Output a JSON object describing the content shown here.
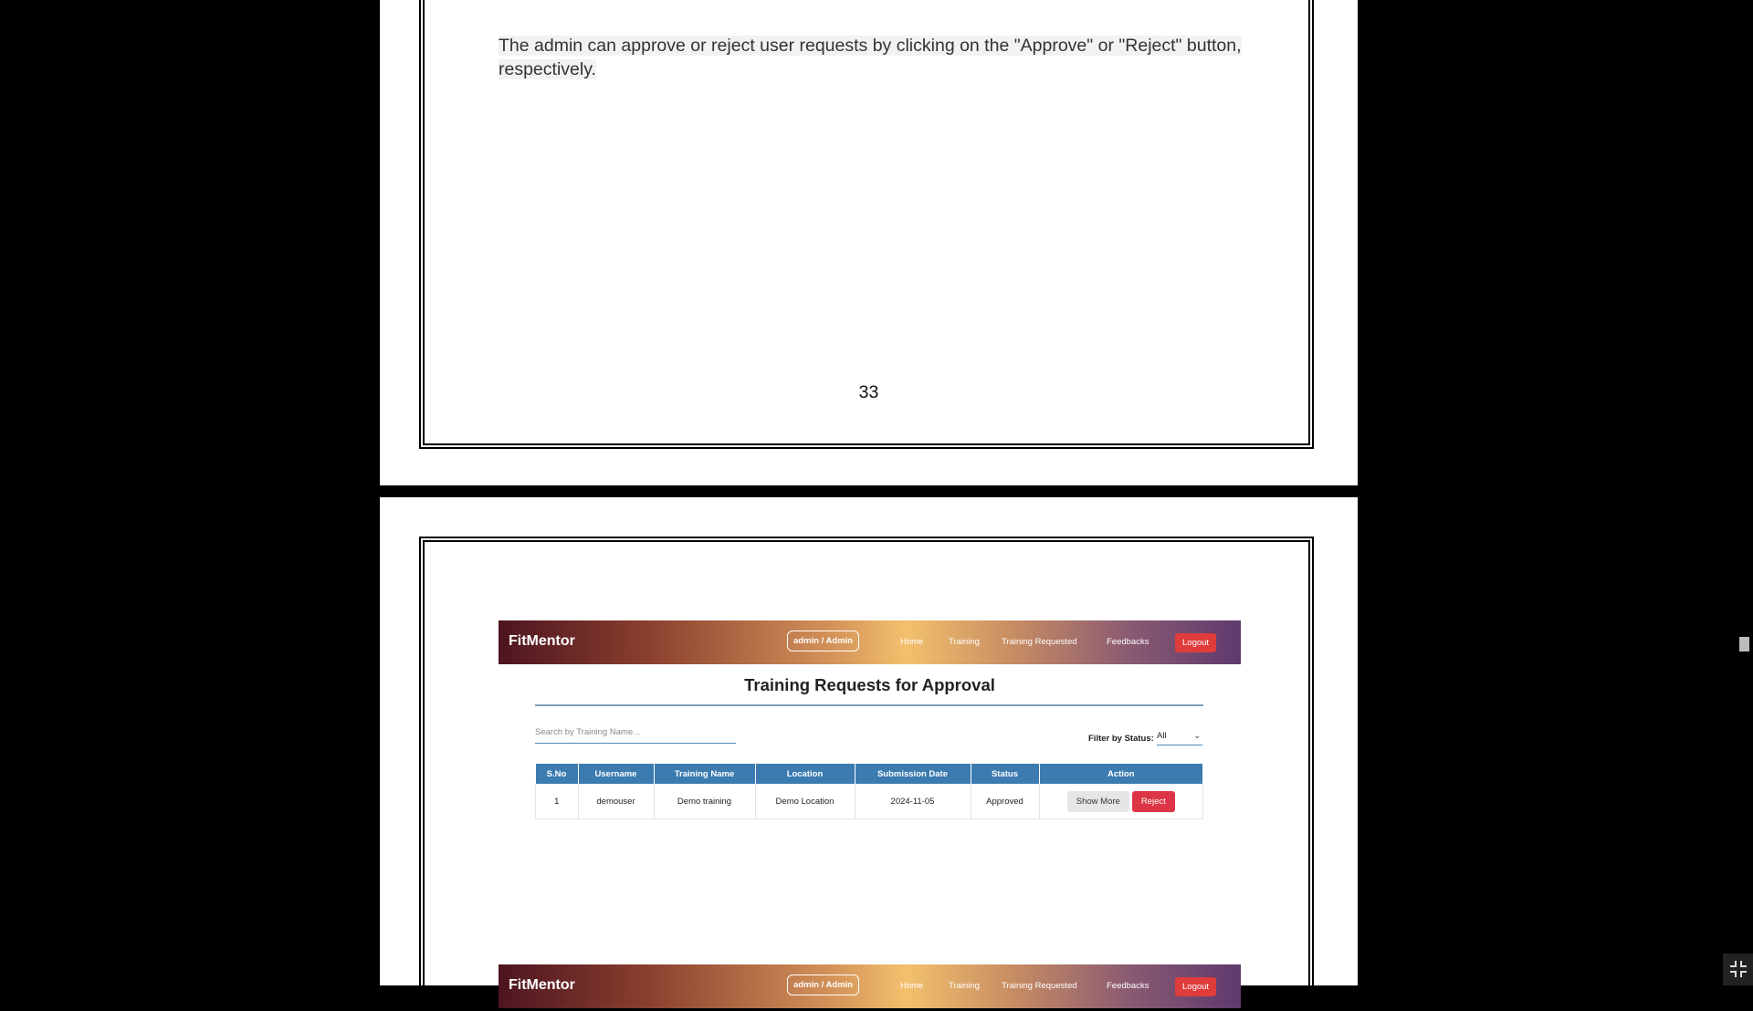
{
  "page1": {
    "paragraph": "The admin can approve or reject user requests by clicking on the \"Approve\" or \"Reject\" button, respectively.",
    "page_number": "33"
  },
  "page2": {
    "screenshot": {
      "brand": "FitMentor",
      "role_badge": "admin / Admin",
      "nav": [
        "Home",
        "Training",
        "Training Requested",
        "Feedbacks"
      ],
      "logout": "Logout",
      "title": "Training Requests for Approval",
      "search_placeholder": "Search by Training Name...",
      "filter_label": "Filter by Status:",
      "filter_value": "All",
      "columns": [
        "S.No",
        "Username",
        "Training Name",
        "Location",
        "Submission Date",
        "Status",
        "Action"
      ],
      "rows": [
        {
          "sno": "1",
          "username": "demouser",
          "training": "Demo training",
          "location": "Demo Location",
          "date": "2024-11-05",
          "status": "Approved",
          "show_more": "Show More",
          "reject": "Reject"
        }
      ]
    },
    "screenshot2": {
      "brand": "FitMentor",
      "role_badge": "admin / Admin",
      "nav": [
        "Home",
        "Training",
        "Training Requested",
        "Feedbacks"
      ],
      "logout": "Logout"
    }
  },
  "colors": {
    "accent": "#3b7bb0",
    "danger": "#dc3545"
  },
  "icons": {
    "fullscreen": "exit-fullscreen-icon"
  }
}
